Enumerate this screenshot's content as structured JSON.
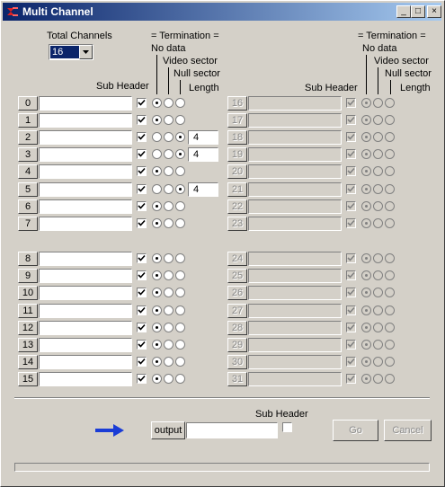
{
  "window": {
    "title": "Multi Channel"
  },
  "titlebar_buttons": {
    "minimize": "_",
    "maximize": "□",
    "close": "×"
  },
  "total_channels": {
    "label": "Total Channels",
    "value": "16"
  },
  "header_left": {
    "termination": "= Termination =",
    "no_data": "No data",
    "video_sector": "Video sector",
    "null_sector": "Null sector",
    "length": "Length",
    "sub_header": "Sub Header"
  },
  "header_right": {
    "termination": "= Termination =",
    "no_data": "No data",
    "video_sector": "Video sector",
    "null_sector": "Null sector",
    "length": "Length",
    "sub_header": "Sub Header"
  },
  "channels_left": [
    {
      "num": "0",
      "sel": 1,
      "len": ""
    },
    {
      "num": "1",
      "sel": 1,
      "len": ""
    },
    {
      "num": "2",
      "sel": 3,
      "len": "4"
    },
    {
      "num": "3",
      "sel": 3,
      "len": "4"
    },
    {
      "num": "4",
      "sel": 1,
      "len": ""
    },
    {
      "num": "5",
      "sel": 3,
      "len": "4"
    },
    {
      "num": "6",
      "sel": 1,
      "len": ""
    },
    {
      "num": "7",
      "sel": 1,
      "len": ""
    },
    {
      "num": "8",
      "sel": 1,
      "len": ""
    },
    {
      "num": "9",
      "sel": 1,
      "len": ""
    },
    {
      "num": "10",
      "sel": 1,
      "len": ""
    },
    {
      "num": "11",
      "sel": 1,
      "len": ""
    },
    {
      "num": "12",
      "sel": 1,
      "len": ""
    },
    {
      "num": "13",
      "sel": 1,
      "len": ""
    },
    {
      "num": "14",
      "sel": 1,
      "len": ""
    },
    {
      "num": "15",
      "sel": 1,
      "len": ""
    }
  ],
  "channels_right": [
    "16",
    "17",
    "18",
    "19",
    "20",
    "21",
    "22",
    "23",
    "24",
    "25",
    "26",
    "27",
    "28",
    "29",
    "30",
    "31"
  ],
  "bottom": {
    "sub_header_label": "Sub Header",
    "output_button": "output",
    "output_value": "",
    "go_button": "Go",
    "cancel_button": "Cancel",
    "arrow_color": "#1a3cd6"
  }
}
